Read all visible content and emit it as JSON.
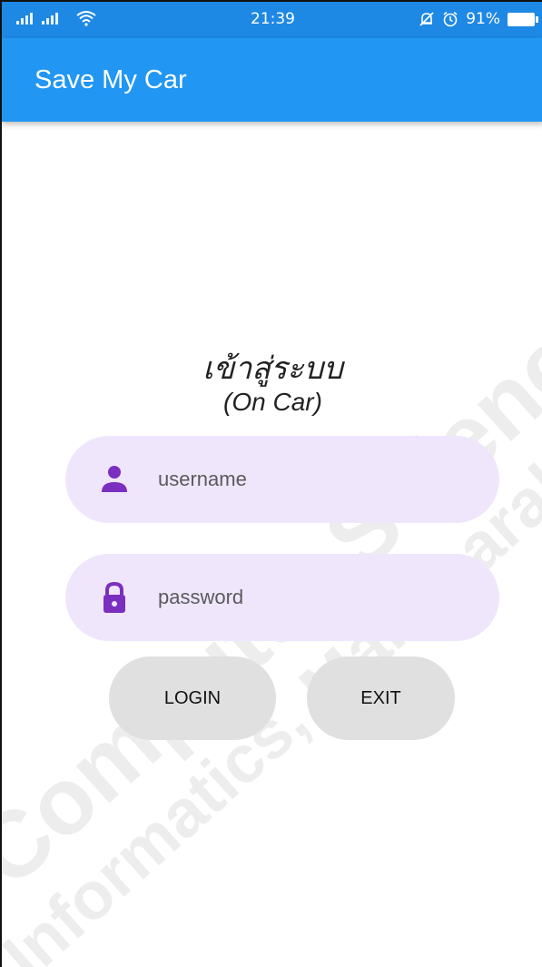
{
  "status_bar": {
    "time": "21:39",
    "battery": "91%",
    "icons": [
      "signal-icon",
      "signal-icon",
      "wifi-icon",
      "mute-icon",
      "alarm-icon",
      "battery-icon"
    ]
  },
  "app_bar": {
    "title": "Save My Car",
    "color": "#2196f3"
  },
  "login": {
    "heading": "เข้าสู่ระบบ",
    "subheading": "(On Car)",
    "username_placeholder": "username",
    "password_placeholder": "password",
    "login_label": "LOGIN",
    "exit_label": "EXIT",
    "field_bg": "#efe6fc",
    "icon_color": "#7b2fbf",
    "button_bg": "#e0e0e0"
  },
  "watermark": {
    "line1": "Computer Science Department",
    "line2": "Informatics, Mahasarakham"
  }
}
